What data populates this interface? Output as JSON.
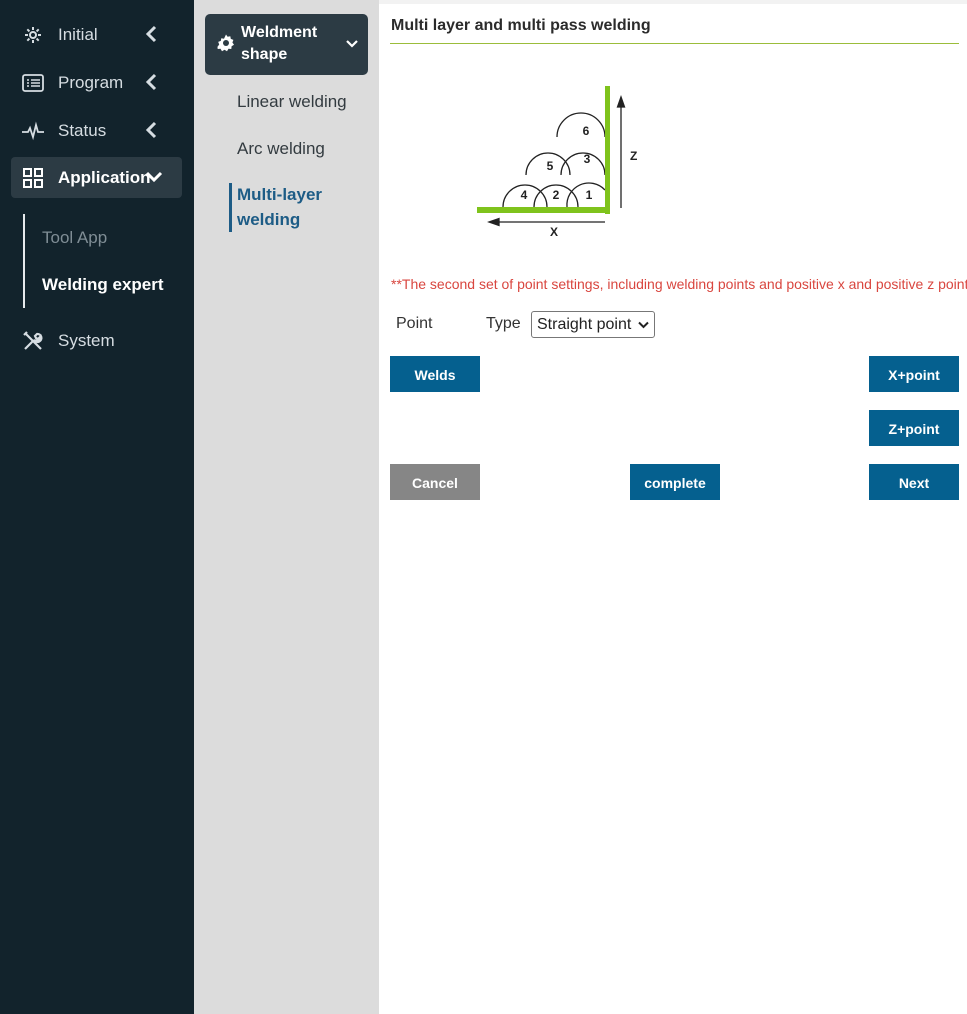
{
  "sidebar": {
    "items": [
      {
        "label": "Initial",
        "icon": "gear-icon"
      },
      {
        "label": "Program",
        "icon": "list-icon"
      },
      {
        "label": "Status",
        "icon": "pulse-icon"
      },
      {
        "label": "Application",
        "icon": "grid-icon"
      },
      {
        "label": "System",
        "icon": "tools-icon"
      }
    ],
    "sub_items": [
      {
        "label": "Tool App"
      },
      {
        "label": "Welding expert"
      }
    ]
  },
  "midpanel": {
    "header": "Weldment shape",
    "items": [
      {
        "label": "Linear welding"
      },
      {
        "label": "Arc welding"
      },
      {
        "label": "Multi-layer welding"
      }
    ]
  },
  "main": {
    "title": "Multi layer and multi pass welding",
    "diagram": {
      "bead_numbers": [
        "1",
        "2",
        "3",
        "4",
        "5",
        "6"
      ],
      "x_axis": "X",
      "z_axis": "Z"
    },
    "note": "**The second set of point settings, including welding points and positive x and positive z points",
    "point_label": "Point",
    "type_label": "Type",
    "type_value": "Straight point",
    "buttons": {
      "welds": "Welds",
      "x_point": "X+point",
      "z_point": "Z+point",
      "cancel": "Cancel",
      "complete": "complete",
      "next": "Next"
    }
  },
  "colors": {
    "sidebar_bg": "#12232c",
    "active_bg": "#2c3b44",
    "accent_blue": "#05608f",
    "accent_green": "#7fc31c",
    "note_red": "#d9463f"
  }
}
